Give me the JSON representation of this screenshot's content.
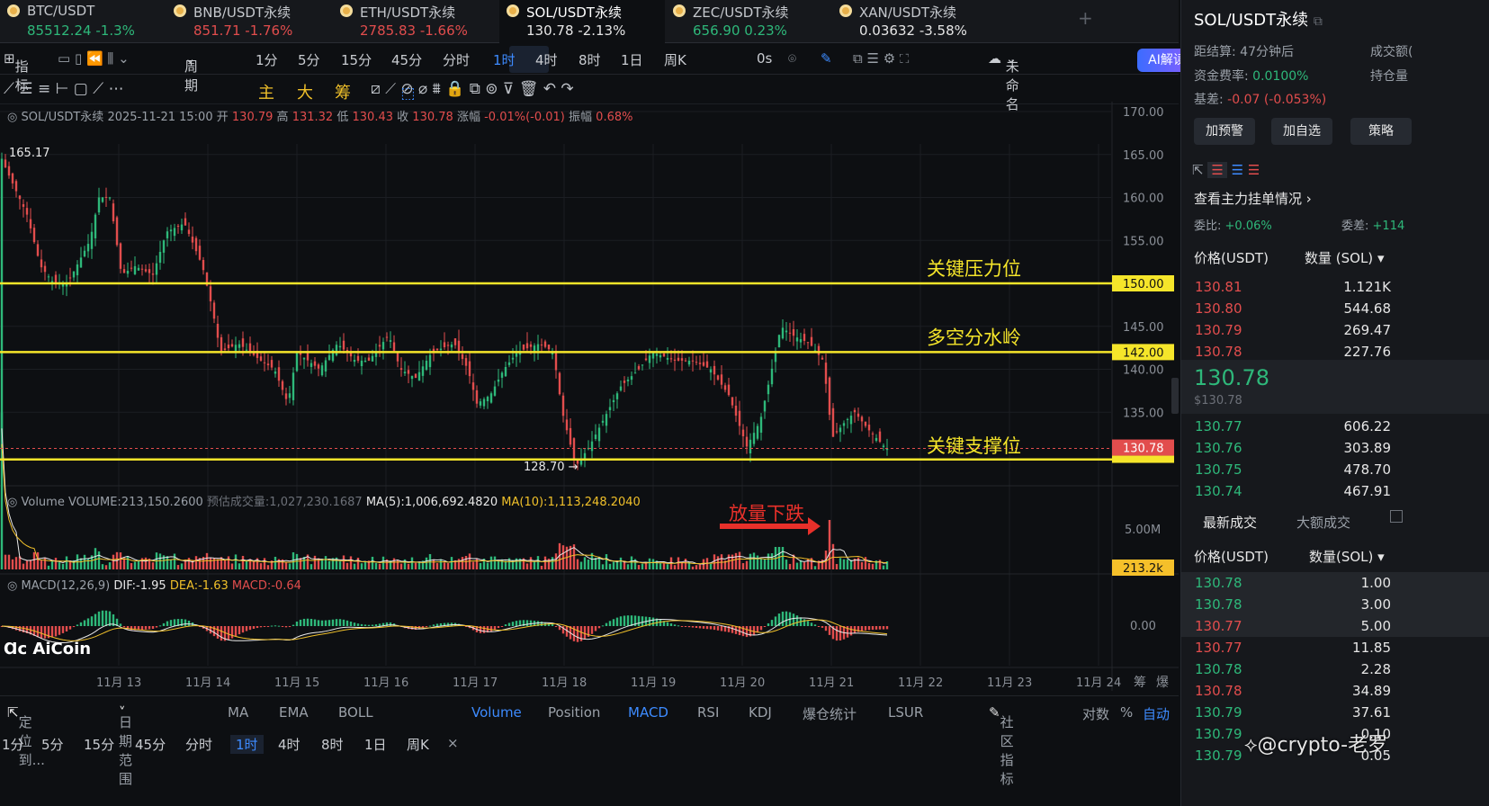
{
  "tabs": [
    {
      "name": "BTC/USDT",
      "price": "85512.24",
      "change": "-1.3%",
      "dir": "up"
    },
    {
      "name": "BNB/USDT永续",
      "price": "851.71",
      "change": "-1.76%",
      "dir": "down"
    },
    {
      "name": "ETH/USDT永续",
      "price": "2785.83",
      "change": "-1.66%",
      "dir": "down"
    },
    {
      "name": "SOL/USDT永续",
      "price": "130.78",
      "change": "-2.13%",
      "dir": "act"
    },
    {
      "name": "ZEC/USDT永续",
      "price": "656.90",
      "change": "0.23%",
      "dir": "up"
    },
    {
      "name": "XAN/USDT永续",
      "price": "0.03632",
      "change": "-3.58%",
      "dir": "act"
    }
  ],
  "toolbar": {
    "indicator": "指标",
    "period": "周期",
    "intervals": [
      "1分",
      "5分",
      "15分",
      "45分",
      "分时",
      "1时",
      "4时",
      "8时",
      "1日",
      "周K"
    ],
    "selected": "1时",
    "countdown": "0s",
    "layout": "未命名",
    "ai": "AI解读"
  },
  "drawtools": {
    "main": "主",
    "big": "大",
    "chips": "筹"
  },
  "ohlc": {
    "symbol": "SOL/USDT永续",
    "time": "2025-11-21 15:00",
    "open_l": "开",
    "open": "130.79",
    "high_l": "高",
    "high": "131.32",
    "low_l": "低",
    "low": "130.43",
    "close_l": "收",
    "close": "130.78",
    "chg_l": "涨幅",
    "chg": "-0.01%(-0.01)",
    "amp_l": "振幅",
    "amp": "0.68%"
  },
  "price_axis": [
    "170.00",
    "165.00",
    "160.00",
    "155.00",
    "150.00",
    "145.00",
    "142.00",
    "140.00",
    "135.00",
    "130.78"
  ],
  "annotations": {
    "resistance": "关键压力位",
    "divide": "多空分水岭",
    "support": "关键支撑位",
    "high": "165.17",
    "low": "128.70",
    "vol_note": "放量下跌"
  },
  "levels": {
    "resistance": 150,
    "divide": 142,
    "support": 129.5,
    "last": 130.78
  },
  "volume": {
    "label": "Volume",
    "value": "VOLUME:213,150.2600",
    "est": "预估成交量:1,027,230.1687",
    "ma5": "MA(5):1,006,692.4820",
    "ma10": "MA(10):1,113,248.2040",
    "axis": "5.00M",
    "last": "213.2k"
  },
  "macd": {
    "label": "MACD(12,26,9)",
    "dif": "DIF:-1.95",
    "dea": "DEA:-1.63",
    "macd": "MACD:-0.64",
    "zero": "0.00"
  },
  "dates": [
    "11月 13",
    "11月 14",
    "11月 15",
    "11月 16",
    "11月 17",
    "11月 18",
    "11月 19",
    "11月 20",
    "11月 21",
    "11月 22",
    "11月 23",
    "11月 24"
  ],
  "corner": [
    "筹",
    "爆"
  ],
  "logo": "AiCoin",
  "bottom1": {
    "locate": "定位到...",
    "range": "日期范围",
    "items": [
      "MA",
      "EMA",
      "BOLL",
      "Volume",
      "Position",
      "MACD",
      "RSI",
      "KDJ",
      "爆仓统计",
      "LSUR"
    ],
    "community": "社区指标",
    "log": "对数",
    "pct": "%",
    "auto": "自动"
  },
  "bottom2": [
    "1分",
    "5分",
    "15分",
    "45分",
    "分时",
    "1时",
    "4时",
    "8时",
    "1日",
    "周K"
  ],
  "panel": {
    "title": "SOL/USDT永续",
    "settle_l": "距结算:",
    "settle": "47分钟后",
    "vol_l": "成交额(",
    "fund_l": "资金费率:",
    "fund": "0.0100%",
    "oi_l": "持仓量",
    "basis_l": "基差:",
    "basis": "-0.07 (-0.053%)",
    "btns": [
      "加预警",
      "加自选",
      "策略"
    ],
    "depth_link": "查看主力挂单情况",
    "wb_l": "委比:",
    "wb": "+0.06%",
    "wc_l": "委差:",
    "wc": "+114",
    "col_price": "价格(USDT)",
    "col_qty": "数量 (SOL)",
    "asks": [
      [
        "130.81",
        "1.121K"
      ],
      [
        "130.80",
        "544.68"
      ],
      [
        "130.79",
        "269.47"
      ],
      [
        "130.78",
        "227.76"
      ]
    ],
    "last": "130.78",
    "last_usd": "$130.78",
    "bids": [
      [
        "130.77",
        "606.22"
      ],
      [
        "130.76",
        "303.89"
      ],
      [
        "130.75",
        "478.70"
      ],
      [
        "130.74",
        "467.91"
      ]
    ],
    "trade_tabs": [
      "最新成交",
      "大额成交"
    ],
    "trade_col_qty": "数量(SOL)",
    "trades": [
      [
        "130.78",
        "1.00",
        "up"
      ],
      [
        "130.78",
        "3.00",
        "up"
      ],
      [
        "130.77",
        "5.00",
        "down"
      ],
      [
        "130.77",
        "11.85",
        "down"
      ],
      [
        "130.78",
        "2.28",
        "up"
      ],
      [
        "130.78",
        "34.89",
        "down"
      ],
      [
        "130.79",
        "37.61",
        "up"
      ],
      [
        "130.79",
        "0.10",
        "up"
      ],
      [
        "130.79",
        "0.05",
        "up"
      ]
    ],
    "watermark": "@crypto-老罗"
  }
}
